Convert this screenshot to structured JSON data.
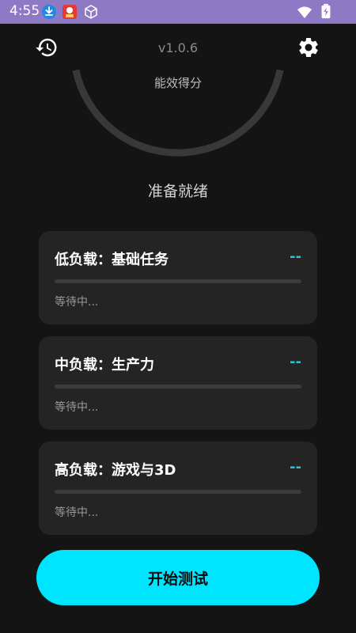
{
  "status_bar": {
    "time": "4:55",
    "icons": [
      "download-icon",
      "app-notification-icon",
      "cube-icon",
      "wifi-icon",
      "battery-charging-icon"
    ]
  },
  "header": {
    "version": "v1.0.6",
    "history_icon": "history-icon",
    "settings_icon": "gear-icon"
  },
  "gauge": {
    "label": "能效得分",
    "value": 0
  },
  "status_text": "准备就绪",
  "cards": [
    {
      "title": "低负载：基础任务",
      "score": "--",
      "progress": 0,
      "status": "等待中..."
    },
    {
      "title": "中负载：生产力",
      "score": "--",
      "progress": 0,
      "status": "等待中..."
    },
    {
      "title": "高负载：游戏与3D",
      "score": "--",
      "progress": 0,
      "status": "等待中..."
    }
  ],
  "start_button": {
    "label": "开始测试"
  },
  "colors": {
    "accent": "#00e5ff",
    "score_dash": "#1ec8d6",
    "status_bar": "#8e79c4",
    "background": "#141414",
    "card": "#242424"
  }
}
